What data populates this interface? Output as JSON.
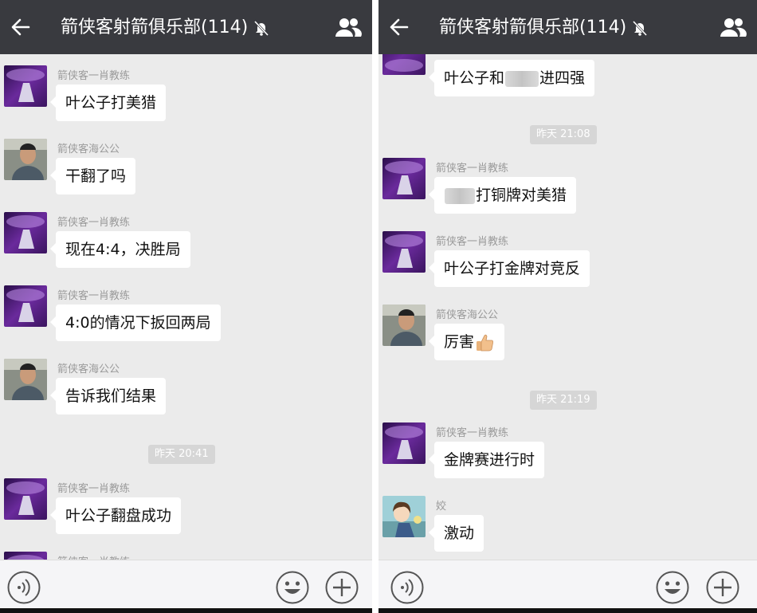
{
  "left": {
    "header": {
      "title": "箭侠客射箭俱乐部(114)"
    },
    "messages": [
      {
        "sender": "箭侠客一肖教练",
        "text": "叶公子打美猎",
        "avatar": "purple"
      },
      {
        "sender": "箭侠客海公公",
        "text": "干翻了吗",
        "avatar": "photo"
      },
      {
        "sender": "箭侠客一肖教练",
        "text": "现在4:4，决胜局",
        "avatar": "purple"
      },
      {
        "sender": "箭侠客一肖教练",
        "text": "4:0的情况下扳回两局",
        "avatar": "purple"
      },
      {
        "sender": "箭侠客海公公",
        "text": "告诉我们结果",
        "avatar": "photo"
      },
      {
        "timestamp": "昨天 20:41"
      },
      {
        "sender": "箭侠客一肖教练",
        "text": "叶公子翻盘成功",
        "avatar": "purple"
      },
      {
        "sender": "箭侠客一肖教练",
        "avatar": "purple"
      }
    ]
  },
  "right": {
    "header": {
      "title": "箭侠客射箭俱乐部(114)"
    },
    "messages": [
      {
        "text_before": "叶公子和",
        "text_after": "进四强",
        "avatar": "purple"
      },
      {
        "timestamp": "昨天 21:08"
      },
      {
        "sender": "箭侠客一肖教练",
        "text_after": "打铜牌对美猎",
        "avatar": "purple"
      },
      {
        "sender": "箭侠客一肖教练",
        "text": "叶公子打金牌对竞反",
        "avatar": "purple"
      },
      {
        "sender": "箭侠客海公公",
        "text": "厉害",
        "emoji": "thumbs-up",
        "avatar": "photo"
      },
      {
        "timestamp": "昨天 21:19"
      },
      {
        "sender": "箭侠客一肖教练",
        "text": "金牌赛进行时",
        "avatar": "purple"
      },
      {
        "sender": "姣",
        "text": "激动",
        "avatar": "cartoon"
      }
    ]
  },
  "colors": {
    "header_bg": "#393a3f",
    "chat_bg": "#ebebeb",
    "bubble_bg": "#ffffff",
    "sender_text": "#9a9a9a",
    "timestamp_bg": "#d6d6d6"
  },
  "icons": [
    "back-arrow-icon",
    "mute-bell-icon",
    "group-members-icon",
    "voice-icon",
    "emoji-icon",
    "plus-icon",
    "thumbs-up-emoji"
  ]
}
